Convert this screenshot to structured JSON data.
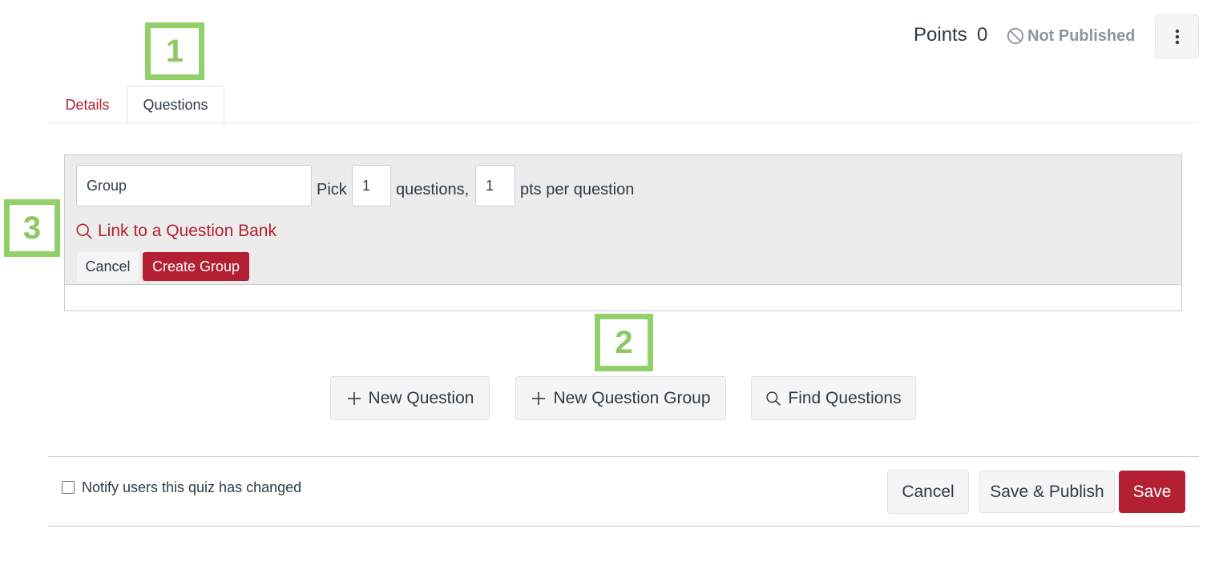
{
  "header": {
    "points_label": "Points",
    "points_value": "0",
    "publish_status": "Not Published",
    "publish_icon": "not-published-icon",
    "kebab_icon": "kebab-menu-icon"
  },
  "callouts": {
    "one": "1",
    "two": "2",
    "three": "3"
  },
  "tabs": [
    {
      "label": "Details",
      "active": false
    },
    {
      "label": "Questions",
      "active": true
    }
  ],
  "group_form": {
    "name_value": "Group",
    "pick_label": "Pick",
    "pick_count": "1",
    "questions_label": "questions,",
    "points_per_question": "1",
    "pts_label": "pts per question",
    "bank_link_icon": "search-icon",
    "bank_link_label": "Link to a Question Bank",
    "cancel_label": "Cancel",
    "create_label": "Create Group"
  },
  "actions": {
    "new_question_label": "New Question",
    "new_group_label": "New Question Group",
    "find_questions_label": "Find Questions",
    "plus_icon": "plus-icon",
    "find_icon": "search-icon"
  },
  "footer": {
    "notify_label": "Notify users this quiz has changed",
    "notify_checked": false,
    "cancel_label": "Cancel",
    "save_publish_label": "Save & Publish",
    "save_label": "Save"
  },
  "colors": {
    "brand_red": "#b32033",
    "callout_green": "#92d06a",
    "panel_gray": "#ececec",
    "muted_text": "#8b969e"
  }
}
